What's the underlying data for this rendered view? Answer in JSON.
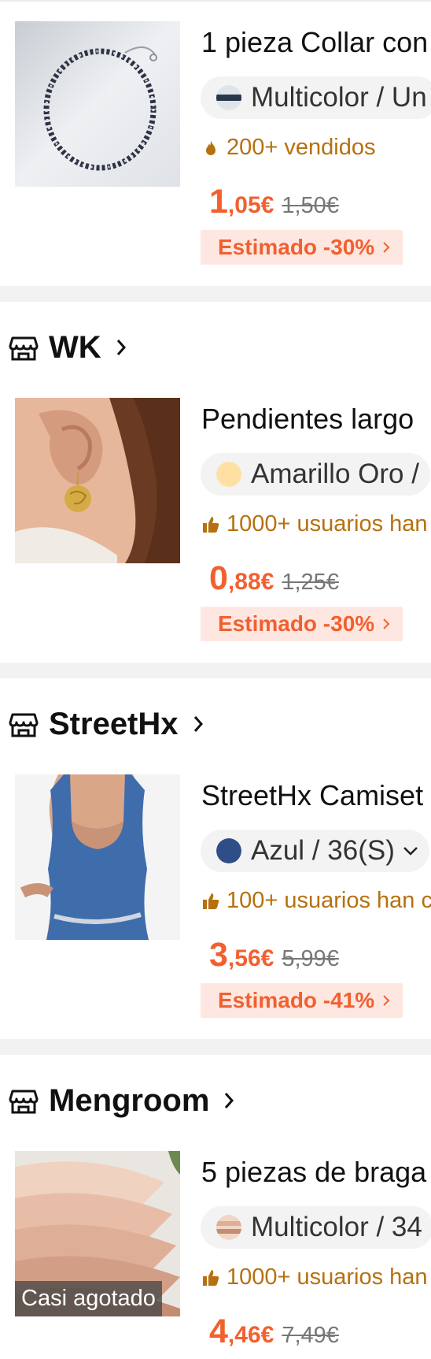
{
  "products": [
    {
      "title": "1 pieza Collar con",
      "variant": "Multicolor / Un",
      "social_text": "200+ vendidos",
      "social_icon": "flame-icon",
      "price_int": "1",
      "price_dec": ",05€",
      "price_old": "1,50€",
      "estimate": "Estimado -30%"
    },
    {
      "store": "WK",
      "title": "Pendientes largo",
      "variant": "Amarillo Oro /",
      "social_text": "1000+ usuarios han",
      "social_icon": "thumbs-up-icon",
      "price_int": "0",
      "price_dec": ",88€",
      "price_old": "1,25€",
      "estimate": "Estimado -30%"
    },
    {
      "store": "StreetHx",
      "title": "StreetHx Camiset",
      "variant": "Azul / 36(S)",
      "social_text": "100+ usuarios han c",
      "social_icon": "thumbs-up-icon",
      "price_int": "3",
      "price_dec": ",56€",
      "price_old": "5,99€",
      "estimate": "Estimado -41%"
    },
    {
      "store": "Mengroom",
      "title": "5 piezas de braga",
      "variant": "Multicolor / 34",
      "social_text": "1000+ usuarios han",
      "social_icon": "thumbs-up-icon",
      "price_int": "4",
      "price_dec": ",46€",
      "price_old": "7,49€",
      "badge": "Casi agotado"
    }
  ],
  "colors": {
    "price": "#f2602f",
    "estimate_bg": "#ffe7e1",
    "social": "#b7700f",
    "divider": "#f2f2f2",
    "swatch_azul": "#2f4d86",
    "swatch_oro": "#ffe0a3"
  }
}
